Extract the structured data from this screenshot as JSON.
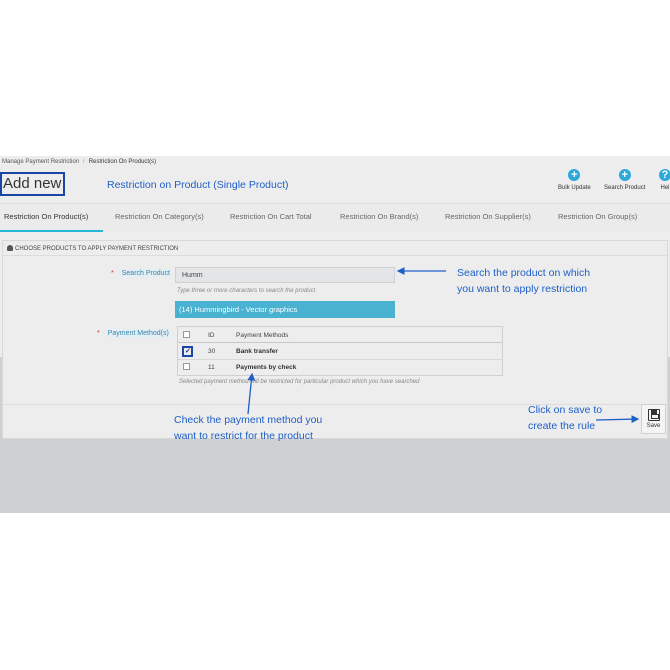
{
  "breadcrumb": {
    "parent": "Manage Payment Restriction",
    "separator": "/",
    "current": "Restriction On Product(s)"
  },
  "header": {
    "add_new": "Add new"
  },
  "annotations": {
    "title": "Restriction on Product (Single Product)",
    "search_line1": "Search the product on which",
    "search_line2": "you want to apply restriction",
    "check_line1": "Check the payment method you",
    "check_line2": "want to restrict for the product",
    "save_line1": "Click on save to",
    "save_line2": "create the rule",
    "color": "#1f5fc8"
  },
  "toolbar": {
    "bulk_update_label": "Bulk Update",
    "search_product_label": "Search Product",
    "help_label": "Hel",
    "bulk_update_icon": "+",
    "search_product_icon": "+",
    "help_icon": "?",
    "icon_color": "#2ea8d8"
  },
  "tabs": [
    {
      "label": "Restriction On Product(s)",
      "active": true
    },
    {
      "label": "Restriction On Category(s)"
    },
    {
      "label": "Restriction On Cart Total"
    },
    {
      "label": "Restriction On Brand(s)"
    },
    {
      "label": "Restriction On Supplier(s)"
    },
    {
      "label": "Restriction On Group(s)"
    }
  ],
  "panel": {
    "heading": "CHOOSE PRODUCTS TO APPLY PAYMENT RESTRICTION",
    "search_label": "Search Product",
    "required_mark": "*",
    "search_value": "Humm",
    "search_hint": "Type three or more characters to search the product",
    "suggestion": "(14) Hummingbird - Vector graphics",
    "payment_label": "Payment Method(s)",
    "payment_table": {
      "headers": {
        "id": "ID",
        "name": "Payment Methods"
      },
      "rows": [
        {
          "id": "30",
          "name": "Bank transfer",
          "checked": true
        },
        {
          "id": "11",
          "name": "Payments by check",
          "checked": false
        }
      ]
    },
    "payment_hint": "Selected payment method will be restricted for particular product which you have searched",
    "save_label": "Save"
  }
}
